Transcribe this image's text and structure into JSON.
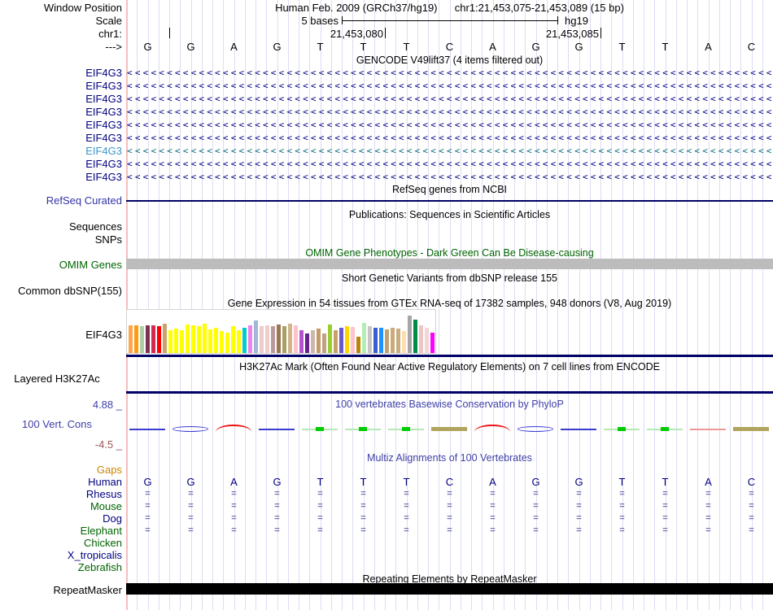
{
  "header": {
    "window_position_label": "Window Position",
    "assembly_title": "Human Feb. 2009 (GRCh37/hg19)",
    "position_title": "chr1:21,453,075-21,453,089 (15 bp)",
    "scale_label": "Scale",
    "scale_value": "5 bases",
    "scale_genome": "hg19",
    "chrom_label": "chr1:",
    "coord_left": "21,453,080",
    "coord_right": "21,453,085",
    "strand_label": "--->",
    "sequence": [
      "G",
      "G",
      "A",
      "G",
      "T",
      "T",
      "T",
      "C",
      "A",
      "G",
      "G",
      "T",
      "T",
      "A",
      "C"
    ]
  },
  "colors": {
    "navy": "#000080",
    "dark_line": "#000066",
    "teal_label": "#3a96c8",
    "teal_arrows": "#0b6d7c",
    "track_blue": "#3333a6",
    "slate_blue": "#4040a8",
    "green": "#006400",
    "orange_gaps": "#cd8500",
    "maroon_min": "#9b5454",
    "omim_gray": "#bcbcbc",
    "align_mark": "#7878b4",
    "grid": "#dcdcf2",
    "pink_guide": "#f7bcbc"
  },
  "gencode": {
    "title": "GENCODE V49lift37 (4 items filtered out)",
    "arrow_char": "<",
    "gene_rows": [
      {
        "label": "EIF4G3",
        "variant": "normal"
      },
      {
        "label": "EIF4G3",
        "variant": "normal"
      },
      {
        "label": "EIF4G3",
        "variant": "normal"
      },
      {
        "label": "EIF4G3",
        "variant": "normal"
      },
      {
        "label": "EIF4G3",
        "variant": "normal"
      },
      {
        "label": "EIF4G3",
        "variant": "normal"
      },
      {
        "label": "EIF4G3",
        "variant": "teal"
      },
      {
        "label": "EIF4G3",
        "variant": "normal"
      },
      {
        "label": "EIF4G3",
        "variant": "normal"
      }
    ]
  },
  "refseq": {
    "title": "RefSeq genes from NCBI",
    "label": "RefSeq Curated"
  },
  "publications": {
    "title": "Publications: Sequences in Scientific Articles",
    "label_sequences": "Sequences",
    "label_snps": "SNPs"
  },
  "omim": {
    "title": "OMIM Gene Phenotypes - Dark Green Can Be Disease-causing",
    "label": "OMIM Genes"
  },
  "dbsnp": {
    "title": "Short Genetic Variants from dbSNP release 155",
    "label": "Common dbSNP(155)"
  },
  "gtex": {
    "title": "Gene Expression in 54 tissues from GTEx RNA-seq of 17382 samples, 948 donors (V8, Aug 2019)",
    "label": "EIF4G3",
    "bars": [
      {
        "c": "#ffa54f",
        "h": 34
      },
      {
        "c": "#ff9912",
        "h": 34
      },
      {
        "c": "#aecfa4",
        "h": 33
      },
      {
        "c": "#7d3253",
        "h": 34
      },
      {
        "c": "#d42a50",
        "h": 34
      },
      {
        "c": "#ff0000",
        "h": 33
      },
      {
        "c": "#c9a46c",
        "h": 36
      },
      {
        "c": "#ffff00",
        "h": 28
      },
      {
        "c": "#ffff00",
        "h": 30
      },
      {
        "c": "#ffff00",
        "h": 28
      },
      {
        "c": "#ffff00",
        "h": 35
      },
      {
        "c": "#ffff00",
        "h": 34
      },
      {
        "c": "#ffff00",
        "h": 33
      },
      {
        "c": "#ffff00",
        "h": 36
      },
      {
        "c": "#ffff00",
        "h": 29
      },
      {
        "c": "#ffff00",
        "h": 31
      },
      {
        "c": "#ffff00",
        "h": 27
      },
      {
        "c": "#ffff00",
        "h": 25
      },
      {
        "c": "#ffff00",
        "h": 33
      },
      {
        "c": "#ffff00",
        "h": 28
      },
      {
        "c": "#00cdcd",
        "h": 31
      },
      {
        "c": "#ee82ee",
        "h": 34
      },
      {
        "c": "#a0b8d8",
        "h": 40
      },
      {
        "c": "#eecccc",
        "h": 33
      },
      {
        "c": "#f0cccc",
        "h": 34
      },
      {
        "c": "#bc9a9a",
        "h": 33
      },
      {
        "c": "#9b7653",
        "h": 35
      },
      {
        "c": "#ab9f62",
        "h": 33
      },
      {
        "c": "#d2b48c",
        "h": 36
      },
      {
        "c": "#ffc0cb",
        "h": 34
      },
      {
        "c": "#b452cd",
        "h": 28
      },
      {
        "c": "#68228b",
        "h": 24
      },
      {
        "c": "#cbb8a8",
        "h": 28
      },
      {
        "c": "#c49a6c",
        "h": 30
      },
      {
        "c": "#bfa083",
        "h": 24
      },
      {
        "c": "#9acd32",
        "h": 35
      },
      {
        "c": "#c8a165",
        "h": 28
      },
      {
        "c": "#6959cd",
        "h": 31
      },
      {
        "c": "#ffd700",
        "h": 33
      },
      {
        "c": "#ffc1cc",
        "h": 32
      },
      {
        "c": "#b8860b",
        "h": 20
      },
      {
        "c": "#b4eeb4",
        "h": 37
      },
      {
        "c": "#c6c6c6",
        "h": 33
      },
      {
        "c": "#3a5fcd",
        "h": 31
      },
      {
        "c": "#1e90ff",
        "h": 31
      },
      {
        "c": "#bfa26e",
        "h": 29
      },
      {
        "c": "#cdaa7d",
        "h": 31
      },
      {
        "c": "#c8ad7f",
        "h": 30
      },
      {
        "c": "#ffdead",
        "h": 27
      },
      {
        "c": "#a6a6a6",
        "h": 46
      },
      {
        "c": "#008b45",
        "h": 41
      },
      {
        "c": "#eec5c5",
        "h": 34
      },
      {
        "c": "#f2d5d5",
        "h": 31
      },
      {
        "c": "#ff00ff",
        "h": 25
      }
    ]
  },
  "h3k27ac": {
    "title": "H3K27Ac Mark (Often Found Near Active Regulatory Elements) on 7 cell lines from ENCODE",
    "label": "Layered H3K27Ac"
  },
  "conservation": {
    "title": "100 vertebrates Basewise Conservation by PhyloP",
    "label": "100 Vert. Cons",
    "max_label": "4.88 _",
    "min_label": "-4.5 _",
    "marks": [
      "blue-line",
      "blue-ellipse",
      "red-arc",
      "blue-line",
      "green-dot",
      "green-dot",
      "green-dot",
      "khaki-bar",
      "red-arc",
      "blue-ellipse",
      "blue-line",
      "green-dot",
      "green-dot",
      "red-line",
      "khaki-bar"
    ]
  },
  "multiz": {
    "title": "Multiz Alignments of 100 Vertebrates",
    "align_glyph": "=",
    "species": [
      {
        "name": "Gaps",
        "color": "#cd8500",
        "content": "none"
      },
      {
        "name": "Human",
        "color": "#000080",
        "content": "sequence"
      },
      {
        "name": "Rhesus",
        "color": "#000080",
        "content": "align"
      },
      {
        "name": "Mouse",
        "color": "#006400",
        "content": "align"
      },
      {
        "name": "Dog",
        "color": "#000080",
        "content": "align"
      },
      {
        "name": "Elephant",
        "color": "#006400",
        "content": "align"
      },
      {
        "name": "Chicken",
        "color": "#006400",
        "content": "none"
      },
      {
        "name": "X_tropicalis",
        "color": "#000080",
        "content": "none"
      },
      {
        "name": "Zebrafish",
        "color": "#006400",
        "content": "none"
      }
    ]
  },
  "repeatmasker": {
    "title": "Repeating Elements by RepeatMasker",
    "label": "RepeatMasker"
  }
}
